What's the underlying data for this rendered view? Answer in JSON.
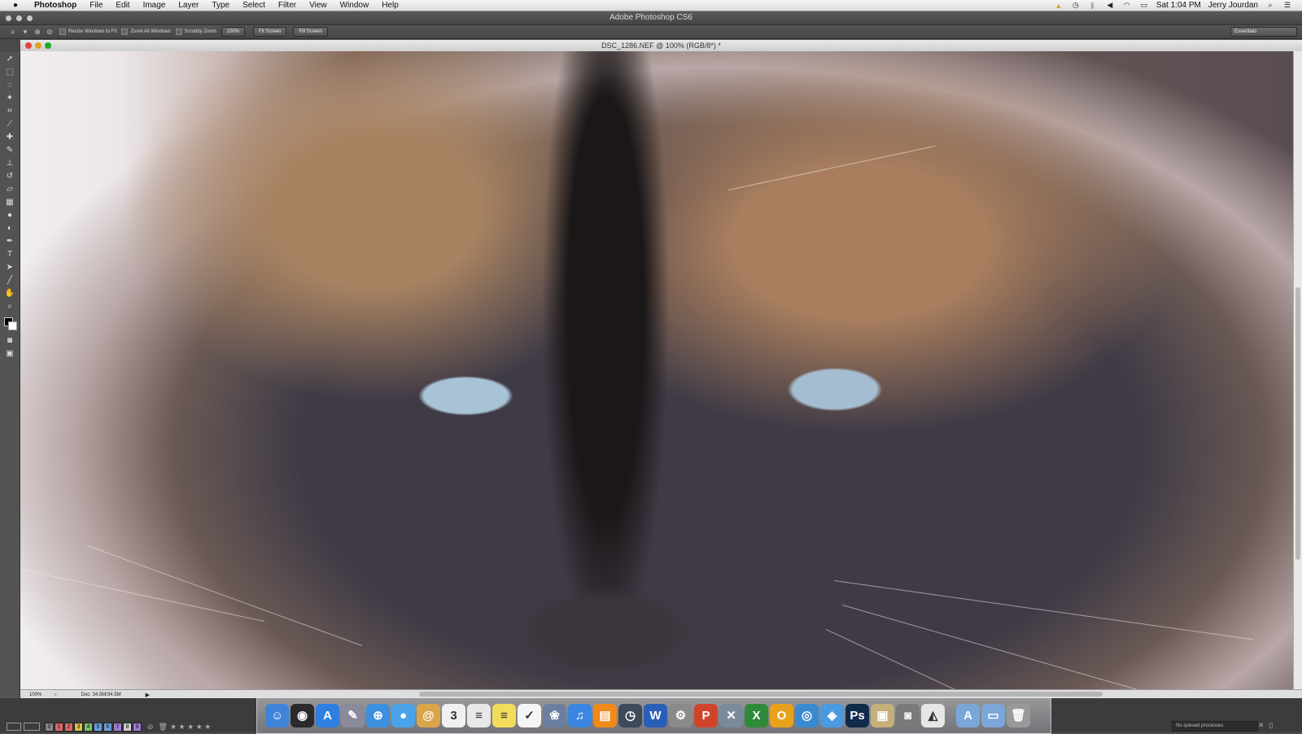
{
  "menubar": {
    "app_name": "Photoshop",
    "menus": [
      "File",
      "Edit",
      "Image",
      "Layer",
      "Type",
      "Select",
      "Filter",
      "View",
      "Window",
      "Help"
    ],
    "clock": "Sat 1:04 PM",
    "user": "Jerry Jourdan",
    "status_icons": [
      "notification-icon",
      "time-machine-icon",
      "bluetooth-icon",
      "volume-icon",
      "wifi-icon",
      "battery-icon",
      "spotlight-icon",
      "list-icon"
    ]
  },
  "app_title": "Adobe Photoshop CS6",
  "options": {
    "tool_icon": "zoom-icon",
    "resize_windows": "Resize Windows to Fit",
    "zoom_all": "Zoom All Windows",
    "scrubby_zoom": "Scrubby Zoom",
    "btn_100": "100%",
    "btn_fit": "Fit Screen",
    "btn_fill": "Fill Screen",
    "workspace": "Essentials"
  },
  "document": {
    "title": "DSC_1286.NEF @ 100% (RGB/8*) *"
  },
  "status": {
    "zoom": "100%",
    "doc_size": "Doc: 34.5M/34.5M"
  },
  "bridge": {
    "labels": [
      "0",
      "1",
      "2",
      "3",
      "4",
      "5",
      "6",
      "7",
      "8",
      "9"
    ],
    "label_colors": [
      "#888888",
      "#d86a6a",
      "#d86a6a",
      "#e0c04a",
      "#7ac26a",
      "#6aa0d8",
      "#6aa0d8",
      "#a07ad8",
      "#cfcfcf",
      "#a07ad8"
    ],
    "stars": "★ ★ ★ ★ ★",
    "queue_status": "No queued processes"
  },
  "dock": {
    "apps": [
      {
        "name": "finder-icon",
        "glyph": "☺",
        "color": "#3f84d8"
      },
      {
        "name": "dashboard-icon",
        "glyph": "◉",
        "color": "#2a2a2a"
      },
      {
        "name": "app-store-icon",
        "glyph": "A",
        "color": "#2f7fe0"
      },
      {
        "name": "preview-icon",
        "glyph": "✎",
        "color": "#8a8a9a"
      },
      {
        "name": "safari-icon",
        "glyph": "⊕",
        "color": "#3d8fe0"
      },
      {
        "name": "messages-icon",
        "glyph": "●",
        "color": "#4aa3e8"
      },
      {
        "name": "contacts-icon",
        "glyph": "@",
        "color": "#d9a44a"
      },
      {
        "name": "calendar-icon",
        "glyph": "3",
        "color": "#f0f0f0"
      },
      {
        "name": "textedit-icon",
        "glyph": "≡",
        "color": "#e8e8e8"
      },
      {
        "name": "notes-icon",
        "glyph": "≡",
        "color": "#f2dc5a"
      },
      {
        "name": "reminders-icon",
        "glyph": "✓",
        "color": "#f5f5f5"
      },
      {
        "name": "iphoto-icon",
        "glyph": "❀",
        "color": "#6c7fa0"
      },
      {
        "name": "itunes-icon",
        "glyph": "♫",
        "color": "#3a86e0"
      },
      {
        "name": "ibooks-icon",
        "glyph": "▤",
        "color": "#f08a1a"
      },
      {
        "name": "time-machine-icon",
        "glyph": "◷",
        "color": "#3c4a5a"
      },
      {
        "name": "word-icon",
        "glyph": "W",
        "color": "#2a5fb8"
      },
      {
        "name": "system-prefs-icon",
        "glyph": "⚙",
        "color": "#8a8a8a"
      },
      {
        "name": "powerpoint-icon",
        "glyph": "P",
        "color": "#d0432b"
      },
      {
        "name": "utility-icon",
        "glyph": "✕",
        "color": "#7a8a9a"
      },
      {
        "name": "excel-icon",
        "glyph": "X",
        "color": "#2f8a3a"
      },
      {
        "name": "outlook-icon",
        "glyph": "O",
        "color": "#e8a21a"
      },
      {
        "name": "network-icon",
        "glyph": "◎",
        "color": "#3a8ad0"
      },
      {
        "name": "bridge-icon",
        "glyph": "◈",
        "color": "#4a9ae0"
      },
      {
        "name": "photoshop-icon",
        "glyph": "Ps",
        "color": "#0f2a4a"
      },
      {
        "name": "screenshot-icon",
        "glyph": "▣",
        "color": "#c6b07a"
      },
      {
        "name": "dvd-icon",
        "glyph": "◙",
        "color": "#7a7a7a"
      },
      {
        "name": "aperture-icon",
        "glyph": "◭",
        "color": "#e6e6e6"
      },
      {
        "name": "applications-folder-icon",
        "glyph": "A",
        "color": "#7aa7d8"
      },
      {
        "name": "documents-folder-icon",
        "glyph": "▭",
        "color": "#7aa7d8"
      },
      {
        "name": "trash-icon",
        "glyph": "🗑",
        "color": "#9a9a9a"
      }
    ]
  }
}
